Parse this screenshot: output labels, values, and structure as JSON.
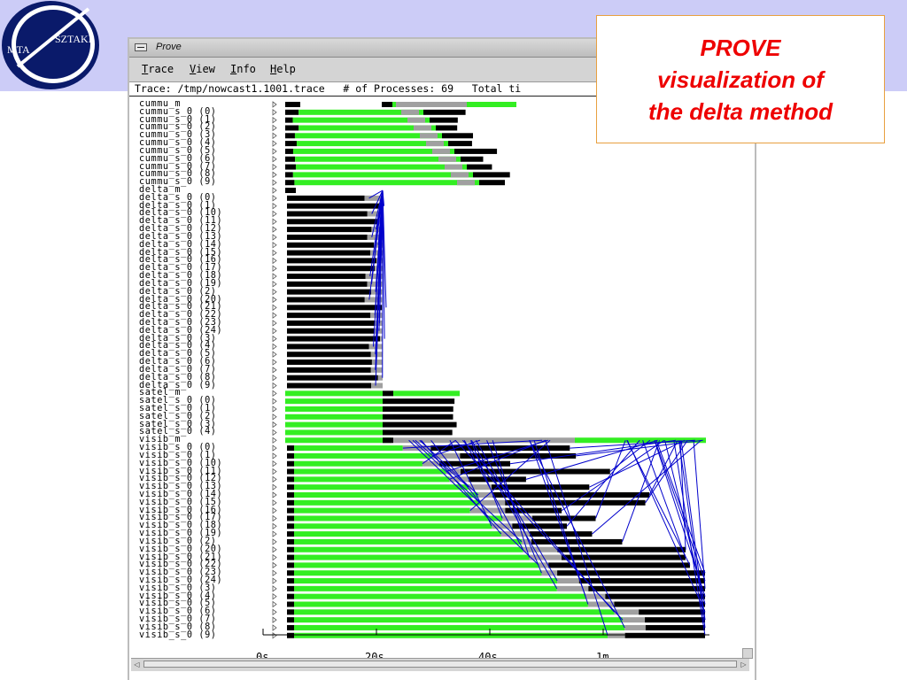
{
  "logo": {
    "text_left": "MTA",
    "text_right": "SZTAKI"
  },
  "callout": {
    "lines": [
      "PROVE",
      "visualization of",
      "the delta method"
    ]
  },
  "window": {
    "title": "Prove",
    "menu": [
      "Trace",
      "View",
      "Info",
      "Help"
    ],
    "status": "Trace: /tmp/nowcast1.1001.trace   # of Processes: 69   Total ti"
  },
  "process_names": [
    "cummu_m",
    "cummu_s_0 (0)",
    "cummu_s_0 (1)",
    "cummu_s_0 (2)",
    "cummu_s_0 (3)",
    "cummu_s_0 (4)",
    "cummu_s_0 (5)",
    "cummu_s_0 (6)",
    "cummu_s_0 (7)",
    "cummu_s_0 (8)",
    "cummu_s_0 (9)",
    "delta_m",
    "delta_s_0 (0)",
    "delta_s_0 (1)",
    "delta_s_0 (10)",
    "delta_s_0 (11)",
    "delta_s_0 (12)",
    "delta_s_0 (13)",
    "delta_s_0 (14)",
    "delta_s_0 (15)",
    "delta_s_0 (16)",
    "delta_s_0 (17)",
    "delta_s_0 (18)",
    "delta_s_0 (19)",
    "delta_s_0 (2)",
    "delta_s_0 (20)",
    "delta_s_0 (21)",
    "delta_s_0 (22)",
    "delta_s_0 (23)",
    "delta_s_0 (24)",
    "delta_s_0 (3)",
    "delta_s_0 (4)",
    "delta_s_0 (5)",
    "delta_s_0 (6)",
    "delta_s_0 (7)",
    "delta_s_0 (8)",
    "delta_s_0 (9)",
    "satel_m",
    "satel_s_0 (0)",
    "satel_s_0 (1)",
    "satel_s_0 (2)",
    "satel_s_0 (3)",
    "satel_s_0 (4)",
    "visib_m",
    "visib_s_0 (0)",
    "visib_s_0 (1)",
    "visib_s_0 (10)",
    "visib_s_0 (11)",
    "visib_s_0 (12)",
    "visib_s_0 (13)",
    "visib_s_0 (14)",
    "visib_s_0 (15)",
    "visib_s_0 (16)",
    "visib_s_0 (17)",
    "visib_s_0 (18)",
    "visib_s_0 (19)",
    "visib_s_0 (2)",
    "visib_s_0 (20)",
    "visib_s_0 (21)",
    "visib_s_0 (22)",
    "visib_s_0 (23)",
    "visib_s_0 (24)",
    "visib_s_0 (3)",
    "visib_s_0 (4)",
    "visib_s_0 (5)",
    "visib_s_0 (6)",
    "visib_s_0 (7)",
    "visib_s_0 (8)",
    "visib_s_0 (9)"
  ],
  "time_axis": {
    "ticks": [
      "0s",
      "20s",
      "40s",
      "1m"
    ]
  },
  "colors": {
    "compute": "#33ee22",
    "communication": "#000000",
    "wait": "#a0a0a0",
    "message_line": "#0000cc",
    "callout_text": "#ee0000",
    "callout_border": "#e8a040",
    "band": "#ccccf7"
  },
  "icons": {
    "window_menu": "window-menu-icon",
    "start_marker": "triangle-marker-icon",
    "scroll_left": "arrow-left-icon",
    "scroll_right": "arrow-right-icon"
  }
}
